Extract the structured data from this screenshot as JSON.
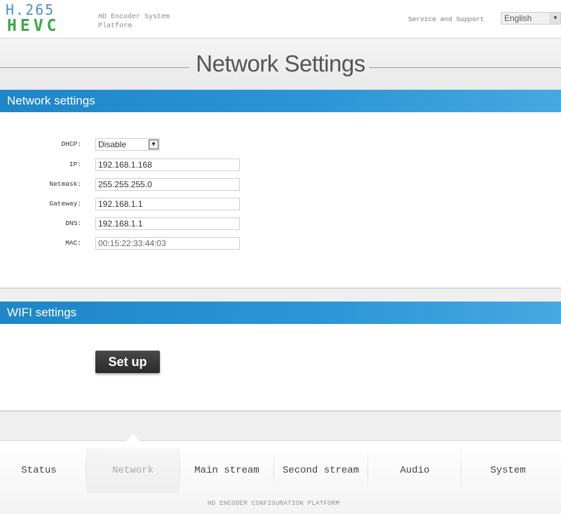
{
  "header": {
    "logo_line1": "H.265",
    "logo_line2": "HEVC",
    "system_name": "HD Encoder System Platform",
    "service_link": "Service and Support",
    "language": "English"
  },
  "page_title": "Network Settings",
  "network_section": {
    "title": "Network settings",
    "dhcp": {
      "label": "DHCP:",
      "value": "Disable"
    },
    "ip": {
      "label": "IP:",
      "value": "192.168.1.168"
    },
    "netmask": {
      "label": "Netmask:",
      "value": "255.255.255.0"
    },
    "gateway": {
      "label": "Gateway:",
      "value": "192.168.1.1"
    },
    "dns": {
      "label": "DNS:",
      "value": "192.168.1.1"
    },
    "mac": {
      "label": "MAC:",
      "value": "00:15:22:33:44:03"
    }
  },
  "wifi_section": {
    "title": "WIFI settings",
    "setup_label": "Set up"
  },
  "nav": {
    "items": [
      {
        "label": "Status"
      },
      {
        "label": "Network"
      },
      {
        "label": "Main stream"
      },
      {
        "label": "Second stream"
      },
      {
        "label": "Audio"
      },
      {
        "label": "System"
      }
    ],
    "active": "Network"
  },
  "footer_text": "HD ENCODER CONFIGURATION PLATFORM",
  "colors": {
    "accent_blue": "#1f86c8",
    "logo_blue": "#4a8fcf",
    "logo_green": "#3aa84a"
  }
}
